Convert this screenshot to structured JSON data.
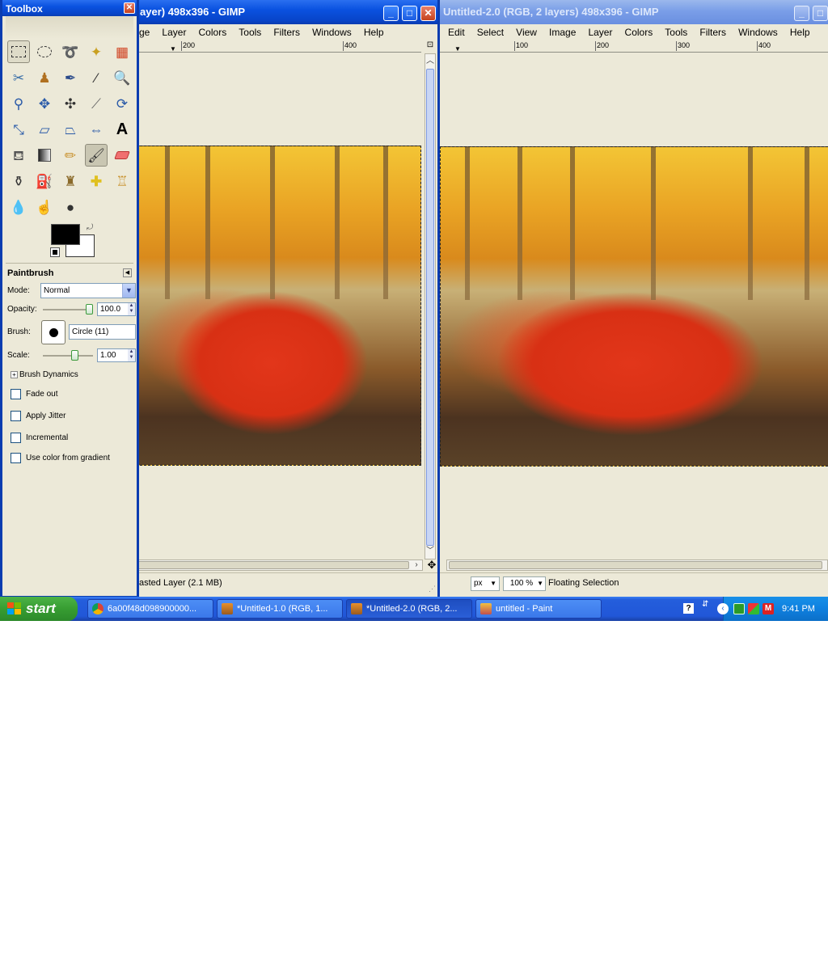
{
  "toolbox": {
    "title": "Toolbox",
    "panel_title": "Paintbrush",
    "mode_label": "Mode:",
    "mode_value": "Normal",
    "opacity_label": "Opacity:",
    "opacity_value": "100.0",
    "opacity_level": 1.0,
    "brush_label": "Brush:",
    "brush_value": "Circle (11)",
    "scale_label": "Scale:",
    "scale_value": "1.00",
    "brush_dynamics": "Brush Dynamics",
    "options": [
      "Fade out",
      "Apply Jitter",
      "Incremental",
      "Use color from gradient"
    ],
    "fg_color": "#000000",
    "bg_color": "#ffffff"
  },
  "window1": {
    "title": "ayer) 498x396 - GIMP",
    "menus": [
      "ge",
      "Layer",
      "Colors",
      "Tools",
      "Filters",
      "Windows",
      "Help"
    ],
    "ruler": [
      "200",
      "400"
    ],
    "status": "asted Layer (2.1 MB)"
  },
  "window2": {
    "title": "Untitled-2.0 (RGB, 2 layers) 498x396 - GIMP",
    "menus": [
      "Edit",
      "Select",
      "View",
      "Image",
      "Layer",
      "Colors",
      "Tools",
      "Filters",
      "Windows",
      "Help"
    ],
    "ruler": [
      "100",
      "200",
      "300",
      "400"
    ],
    "unit": "px",
    "zoom": "100 %",
    "status": "Floating Selection"
  },
  "taskbar": {
    "start": "start",
    "tasks": [
      "6a00f48d098900000...",
      "*Untitled-1.0 (RGB, 1...",
      "*Untitled-2.0 (RGB, 2...",
      "untitled - Paint"
    ],
    "clock": "9:41 PM"
  }
}
